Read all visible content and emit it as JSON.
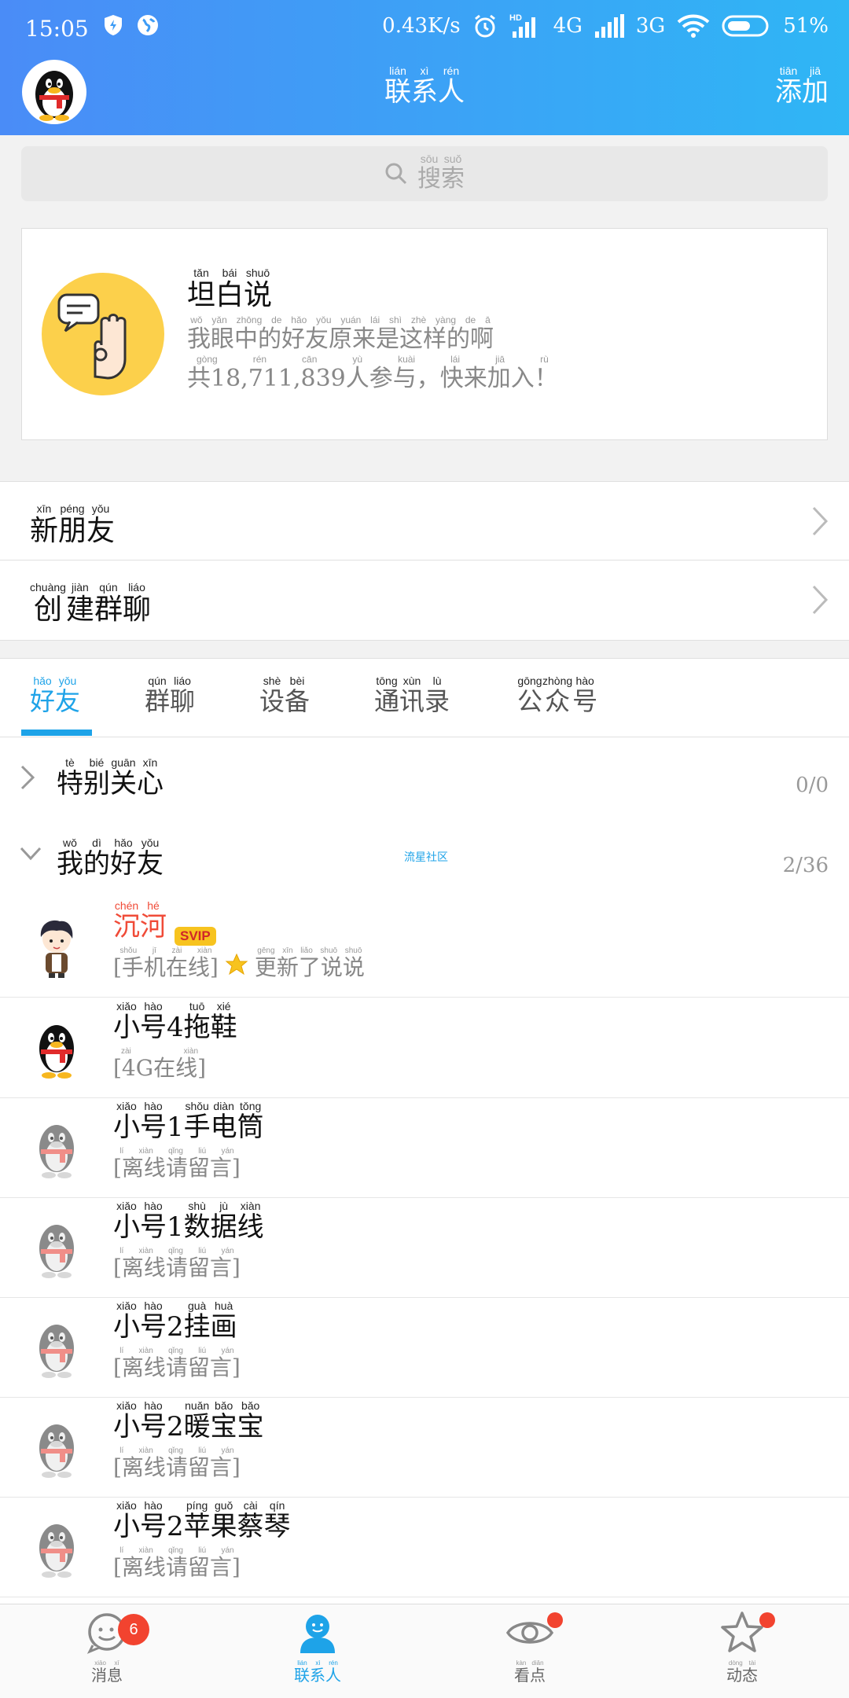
{
  "status": {
    "time": "15:05",
    "speed": "0.43K/s",
    "net1": "4G",
    "net2": "3G",
    "battery": "51%"
  },
  "header": {
    "title": "联系人",
    "title_pinyin": [
      "lián",
      "xì",
      "rén"
    ],
    "title_chars": [
      "联",
      "系",
      "人"
    ],
    "add": [
      "添",
      "加"
    ],
    "add_pinyin": [
      "tiān",
      "jiā"
    ]
  },
  "search": {
    "chars": [
      "搜",
      "索"
    ],
    "pinyin": [
      "sōu",
      "suǒ"
    ]
  },
  "banner": {
    "title_chars": [
      "坦",
      "白",
      "说"
    ],
    "title_pinyin": [
      "tǎn",
      "bái",
      "shuō"
    ],
    "subtitle": "我眼中的好友原来是这样的啊",
    "subtitle_pinyin": "wǒ yǎn zhōng de hǎo yǒu yuán lái shì zhè yàng de ā",
    "count_text": "共18,711,839人参与，快来加入！",
    "count_pinyin": "gòng                    rén cān yù          kuài lái jiā rù"
  },
  "rows": [
    {
      "chars": [
        "新",
        "朋",
        "友"
      ],
      "pinyin": [
        "xīn",
        "péng",
        "yǒu"
      ]
    },
    {
      "chars": [
        "创",
        "建",
        "群",
        "聊"
      ],
      "pinyin": [
        "chuàng",
        "jiàn",
        "qún",
        "liáo"
      ]
    }
  ],
  "tabs": [
    {
      "chars": [
        "好",
        "友"
      ],
      "pinyin": [
        "hǎo",
        "yǒu"
      ]
    },
    {
      "chars": [
        "群",
        "聊"
      ],
      "pinyin": [
        "qún",
        "liáo"
      ]
    },
    {
      "chars": [
        "设",
        "备"
      ],
      "pinyin": [
        "shè",
        "bèi"
      ]
    },
    {
      "chars": [
        "通",
        "讯",
        "录"
      ],
      "pinyin": [
        "tōng",
        "xùn",
        "lù"
      ]
    },
    {
      "chars": [
        "公",
        "众",
        "号"
      ],
      "pinyin": [
        "gōng",
        "zhòng",
        "hào"
      ]
    }
  ],
  "groups": [
    {
      "chars": [
        "特",
        "别",
        "关",
        "心"
      ],
      "pinyin": [
        "tè",
        "bié",
        "guān",
        "xīn"
      ],
      "count": "0/0"
    },
    {
      "chars": [
        "我",
        "的",
        "好",
        "友"
      ],
      "pinyin": [
        "wǒ",
        "dì",
        "hǎo",
        "yǒu"
      ],
      "count": "2/36",
      "tag": "流星社区"
    }
  ],
  "friends": [
    {
      "chars": [
        "沉",
        "河"
      ],
      "pinyin": [
        "chén",
        "hé"
      ],
      "badge": "SVIP",
      "status": "[手机在线]",
      "status_pinyin": "shǒu jī zài xiàn",
      "update": "更新了说说",
      "update_pinyin": "gēng xīn liǎo shuō shuō"
    },
    {
      "chars": [
        "小",
        "号",
        "4",
        "拖",
        "鞋"
      ],
      "pinyin": [
        "xiǎo",
        "hào",
        "",
        "tuō",
        "xié"
      ],
      "status": "[4G在线]",
      "status_pinyin": "zài xiàn"
    },
    {
      "chars": [
        "小",
        "号",
        "1",
        "手",
        "电",
        "筒"
      ],
      "pinyin": [
        "xiǎo",
        "hào",
        "",
        "shǒu",
        "diàn",
        "tǒng"
      ],
      "status": "[离线请留言]",
      "status_pinyin": "lí xiàn qǐng liú yán"
    },
    {
      "chars": [
        "小",
        "号",
        "1",
        "数",
        "据",
        "线"
      ],
      "pinyin": [
        "xiǎo",
        "hào",
        "",
        "shù",
        "jù",
        "xiàn"
      ],
      "status": "[离线请留言]",
      "status_pinyin": "lí xiàn qǐng liú yán"
    },
    {
      "chars": [
        "小",
        "号",
        "2",
        "挂",
        "画"
      ],
      "pinyin": [
        "xiǎo",
        "hào",
        "",
        "guà",
        "huà"
      ],
      "status": "[离线请留言]",
      "status_pinyin": "lí xiàn qǐng liú yán"
    },
    {
      "chars": [
        "小",
        "号",
        "2",
        "暖",
        "宝",
        "宝"
      ],
      "pinyin": [
        "xiǎo",
        "hào",
        "",
        "nuǎn",
        "bǎo",
        "bǎo"
      ],
      "status": "[离线请留言]",
      "status_pinyin": "lí xiàn qǐng liú yán"
    },
    {
      "chars": [
        "小",
        "号",
        "2",
        "苹",
        "果",
        "蔡",
        "琴"
      ],
      "pinyin": [
        "xiǎo",
        "hào",
        "",
        "píng",
        "guǒ",
        "cài",
        "qín"
      ],
      "status": "[离线请留言]",
      "status_pinyin": "lí xiàn qǐng liú yán"
    }
  ],
  "nav": [
    {
      "label": "消息",
      "pinyin": "xiāo xī",
      "badge": "6",
      "icon": "message-icon"
    },
    {
      "label": "联系人",
      "pinyin": "lián xì rén",
      "icon": "contacts-icon"
    },
    {
      "label": "看点",
      "pinyin": "kàn diǎn",
      "dot": true,
      "icon": "eye-icon"
    },
    {
      "label": "动态",
      "pinyin": "dòng tài",
      "dot": true,
      "icon": "star-icon"
    }
  ],
  "colors": {
    "accent": "#1ea3e8",
    "header_start": "#4a8cf7",
    "header_end": "#2fb6f5",
    "badge": "#f2432f",
    "vip_name": "#f04b38"
  }
}
